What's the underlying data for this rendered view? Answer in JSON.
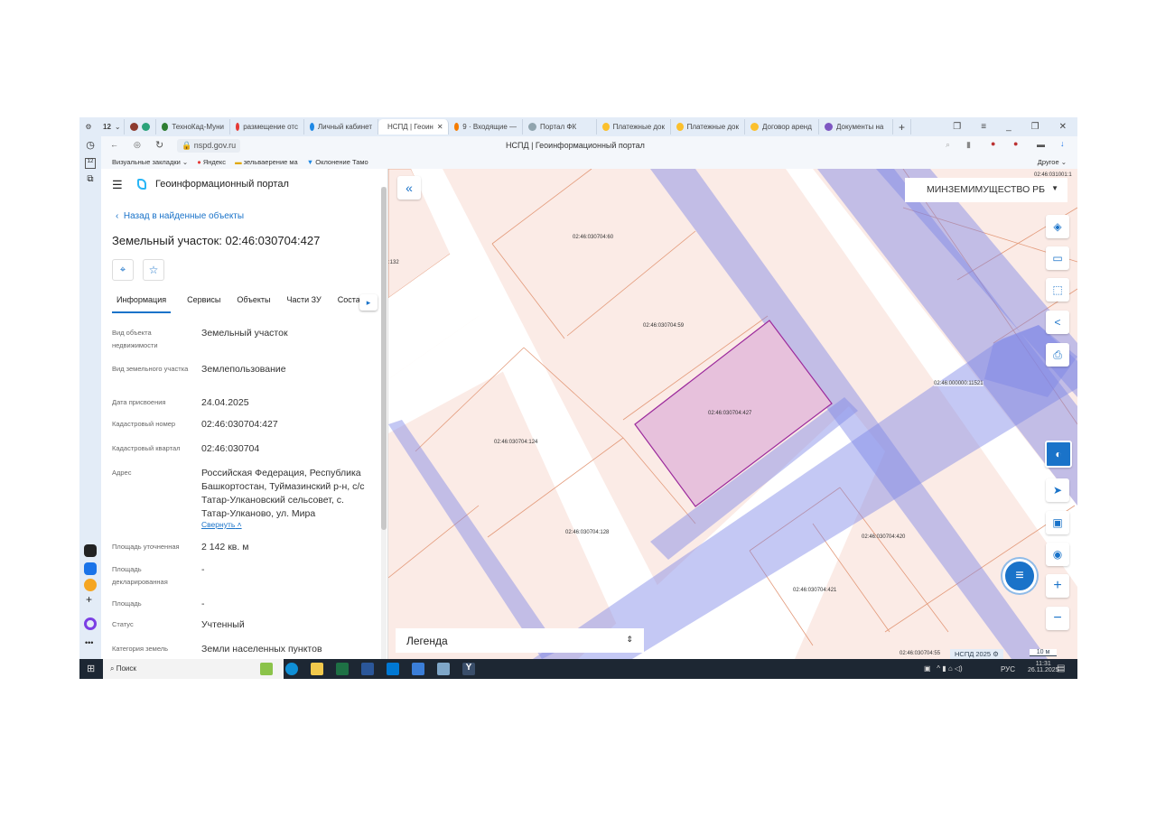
{
  "browser": {
    "tabs": [
      {
        "label": "ТехноКад-Муни",
        "color": "#2e7d32"
      },
      {
        "label": "размещение отс",
        "color": "#e53935"
      },
      {
        "label": "Личный кабинет",
        "color": "#1e88e5"
      },
      {
        "label": "НСПД | Геоин",
        "color": "#29b6f6",
        "active": true
      },
      {
        "label": "9 · Входящие —",
        "color": "#f57c00"
      },
      {
        "label": "Портал ФК",
        "color": "#90a4ae"
      },
      {
        "label": "Платежные док",
        "color": "#fbc02d"
      },
      {
        "label": "Платежные док",
        "color": "#fbc02d"
      },
      {
        "label": "Договор аренд",
        "color": "#fbc02d"
      },
      {
        "label": "Документы на",
        "color": "#7e57c2"
      }
    ],
    "tab_badge": "12",
    "url": "nspd.gov.ru",
    "page_title": "НСПД | Геоинформационный портал",
    "bookmarks": [
      "Визуальные закладки",
      "Яндекс",
      "зельваерение ма",
      "Оклонение Тамо"
    ],
    "bookmarks_other": "Другое"
  },
  "panel": {
    "app_title": "Геоинформационный портал",
    "back_link": "Назад в найденные объекты",
    "object_title": "Земельный участок: 02:46:030704:427",
    "tabs": [
      "Информация",
      "Сервисы",
      "Объекты",
      "Части ЗУ",
      "Соста"
    ],
    "active_tab": 0,
    "fields": [
      {
        "label": "Вид объекта недвижимости",
        "value": "Земельный участок"
      },
      {
        "label": "Вид земельного участка",
        "value": "Землепользование"
      },
      {
        "label": "Дата присвоения",
        "value": "24.04.2025"
      },
      {
        "label": "Кадастровый номер",
        "value": "02:46:030704:427"
      },
      {
        "label": "Кадастровый квартал",
        "value": "02:46:030704"
      },
      {
        "label": "Адрес",
        "value": "Российская Федерация, Республика Башкортостан, Туймазинский р-н, с/с Татар-Улкановский сельсовет, с. Татар-Улканово, ул. Мира"
      },
      {
        "label": "Площадь уточненная",
        "value": "2 142 кв. м"
      },
      {
        "label": "Площадь декларированная",
        "value": "-"
      },
      {
        "label": "Площадь",
        "value": "-"
      },
      {
        "label": "Статус",
        "value": "Учтенный"
      },
      {
        "label": "Категория земель",
        "value": "Земли населенных пунктов"
      }
    ],
    "collapse_link": "Свернуть"
  },
  "map": {
    "org_select": "МИНЗЕМИМУЩЕСТВО РБ",
    "legend": "Легенда",
    "copyright": "НСПД 2025",
    "scale": "10 м",
    "selected_color": "#9c2a9c",
    "labels": [
      "02:46:030704:60",
      "02:46:030704:59",
      "02:46:030704:427",
      "02:46:030704:124",
      "02:46:030704:128",
      "02:46:000000:11521",
      "02:46:030704:420",
      "02:46:030704:421",
      "02:46:030704:55",
      "02:46:031001:1",
      ":132"
    ]
  },
  "taskbar": {
    "search": "Поиск",
    "lang": "РУС",
    "time": "11:31",
    "date": "26.11.2025"
  }
}
